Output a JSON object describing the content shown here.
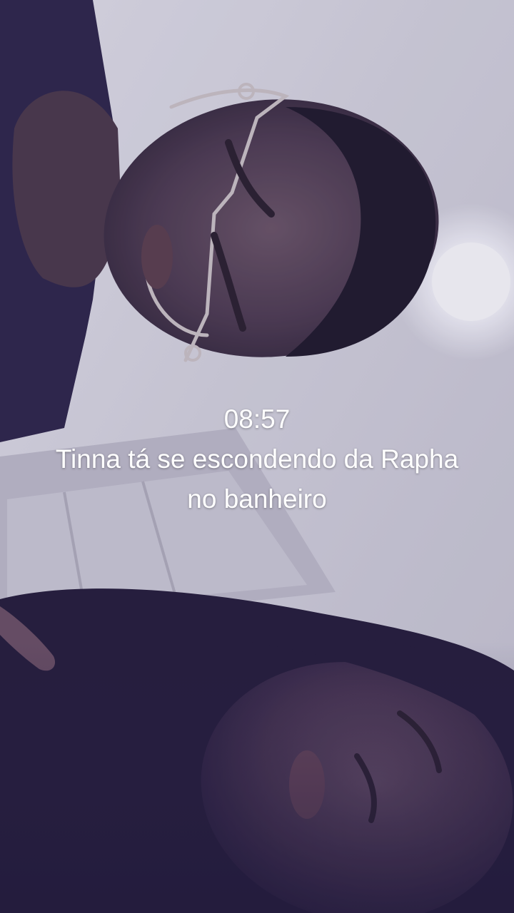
{
  "photo": {
    "icon": "selfie-photo",
    "accent_colors": {
      "ceiling": "#d9d8e2",
      "shadow_purple": "#2c2248",
      "skin_dark": "#3a2a3a",
      "ceiling_light": "#ffffff"
    }
  },
  "caption": {
    "time": "08:57",
    "line1": "Tinna tá se escondendo da Rapha",
    "line2": "no banheiro"
  }
}
